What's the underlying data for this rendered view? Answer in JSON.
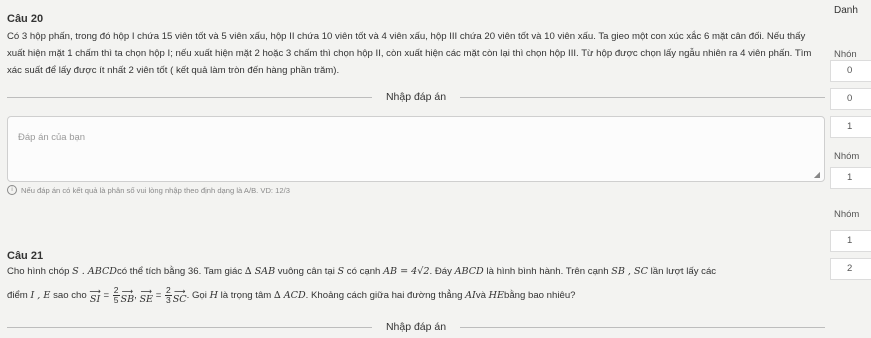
{
  "q20": {
    "label": "Câu 20",
    "text": "Có 3 hộp phấn, trong đó hộp I chứa 15 viên tốt và 5 viên xấu, hộp II chứa 10 viên tốt và 4 viên xấu, hộp III chứa 20 viên tốt và 10 viên xấu. Ta gieo một con xúc xắc 6 mặt cân đối. Nếu thấy xuất hiện mặt 1 chấm thì ta chọn hộp I; nếu xuất hiện mặt 2 hoặc 3 chấm thì chọn hộp II, còn xuất hiện các mặt còn lại thì chọn hộp III. Từ hộp được chọn lấy ngẫu nhiên ra 4 viên phấn. Tìm xác suất để lấy được ít nhất 2 viên tốt ( kết quả làm tròn đến hàng phần trăm).",
    "answer_heading": "Nhập đáp án",
    "answer_placeholder": "Đáp án của bạn",
    "hint": "Nếu đáp án có kết quả là phân số vui lòng nhập theo định dạng là A/B. VD: 12/3"
  },
  "q21": {
    "label": "Câu 21",
    "line1_a": "Cho hình chóp ",
    "line1_b": "S . ABCD",
    "line1_c": "có thể tích bằng 36. Tam giác ",
    "line1_d": "∆ SAB",
    "line1_e": " vuông cân tại ",
    "line1_f": "S",
    "line1_g": " có cạnh ",
    "line1_h": "AB = 4√2",
    "line1_i": ". Đáy ",
    "line1_j": "ABCD",
    "line1_k": " là hình bình hành. Trên cạnh ",
    "line1_l": "SB ,  SC",
    "line1_m": " lần lượt lấy các",
    "line2_a": "điểm ",
    "line2_b": "I ,  E",
    "line2_c": " sao cho ",
    "line2_d": ". Gọi ",
    "line2_e": "H",
    "line2_f": " là trọng tâm ",
    "line2_g": "∆ ACD",
    "line2_h": ". Khoảng cách giữa hai đường thẳng ",
    "line2_i": "AI",
    "line2_j": "và ",
    "line2_k": "HE",
    "line2_l": "bằng bao nhiêu?",
    "answer_heading": "Nhập đáp án"
  },
  "sidebar": {
    "title": "Danh",
    "items": [
      "Nhón",
      "0",
      "0",
      "1",
      "Nhóm",
      "1",
      "Nhóm",
      "1",
      "2"
    ]
  }
}
